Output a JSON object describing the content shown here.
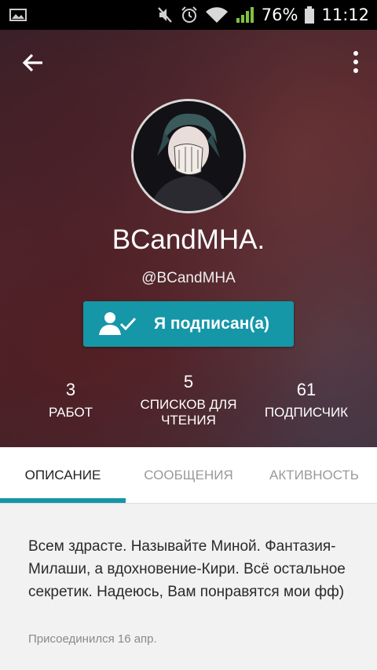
{
  "status_bar": {
    "battery": "76%",
    "time": "11:12",
    "icons": [
      "gallery-icon",
      "mute-icon",
      "alarm-icon",
      "wifi-icon",
      "signal-icon",
      "battery-icon"
    ]
  },
  "header": {
    "back_icon": "arrow-left-icon",
    "menu_icon": "more-vertical-icon"
  },
  "profile": {
    "display_name": "BCandMHA.",
    "username": "@BCandMHA",
    "follow_button_label": "Я подписан(а)",
    "follow_icon": "user-check-icon"
  },
  "stats": [
    {
      "value": "3",
      "label": "РАБОТ"
    },
    {
      "value": "5",
      "label": "СПИСКОВ ДЛЯ ЧТЕНИЯ"
    },
    {
      "value": "61",
      "label": "ПОДПИСЧИК"
    }
  ],
  "tabs": [
    {
      "label": "ОПИСАНИЕ",
      "active": true
    },
    {
      "label": "СООБЩЕНИЯ",
      "active": false
    },
    {
      "label": "АКТИВНОСТЬ",
      "active": false
    }
  ],
  "about": {
    "description": "Всем здрасте. Называйте Миной. Фантазия-Милаши, а вдохновение-Кири. Всё остальное секретик. Надеюсь, Вам понравятся мои фф)",
    "joined": "Присоединился 16 апр."
  },
  "colors": {
    "accent": "#1597a8",
    "status_bar": "#000000",
    "signal": "#7ec242"
  }
}
